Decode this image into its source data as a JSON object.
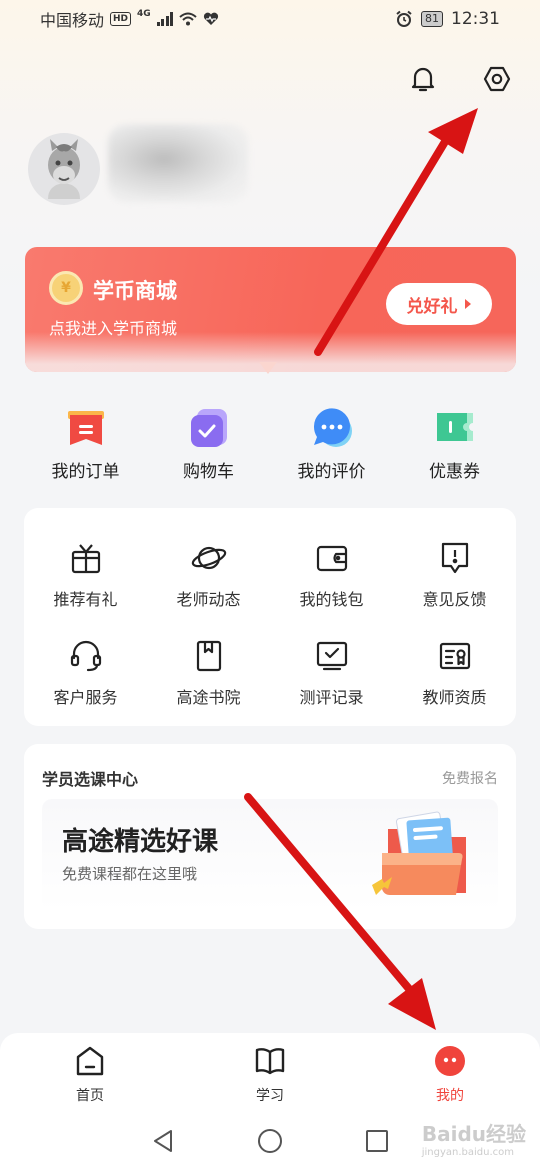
{
  "status_bar": {
    "carrier": "中国移动",
    "hd": "HD",
    "network": "4G",
    "battery": "81",
    "time": "12:31"
  },
  "header": {
    "bell_icon": "bell-icon",
    "settings_icon": "hexagon-settings-icon"
  },
  "coin_mall": {
    "title": "学币商城",
    "subtitle": "点我进入学币商城",
    "button": "兑好礼",
    "colors": {
      "background": "#f76659",
      "button_text": "#f4574c"
    }
  },
  "quick_actions": [
    {
      "label": "我的订单",
      "icon": "order-icon",
      "color": "#f04a42"
    },
    {
      "label": "购物车",
      "icon": "cart-icon",
      "color": "#8a6cf0"
    },
    {
      "label": "我的评价",
      "icon": "comment-icon",
      "color": "#3f8cf7"
    },
    {
      "label": "优惠券",
      "icon": "coupon-icon",
      "color": "#3ec793"
    }
  ],
  "grid_items": [
    {
      "label": "推荐有礼",
      "icon": "gift-icon"
    },
    {
      "label": "老师动态",
      "icon": "planet-icon"
    },
    {
      "label": "我的钱包",
      "icon": "wallet-icon"
    },
    {
      "label": "意见反馈",
      "icon": "feedback-icon"
    },
    {
      "label": "客户服务",
      "icon": "headset-icon"
    },
    {
      "label": "高途书院",
      "icon": "book-icon"
    },
    {
      "label": "测评记录",
      "icon": "assessment-icon"
    },
    {
      "label": "教师资质",
      "icon": "certificate-icon"
    }
  ],
  "course_center": {
    "title": "学员选课中心",
    "more": "免费报名",
    "headline": "高途精选好课",
    "subline": "免费课程都在这里哦"
  },
  "bottom_nav": [
    {
      "label": "首页",
      "icon": "home-icon",
      "active": false
    },
    {
      "label": "学习",
      "icon": "book-open-icon",
      "active": false
    },
    {
      "label": "我的",
      "icon": "profile-dots-icon",
      "active": true
    }
  ],
  "watermark": {
    "text": "Baidu经验",
    "sub": "jingyan.baidu.com"
  }
}
